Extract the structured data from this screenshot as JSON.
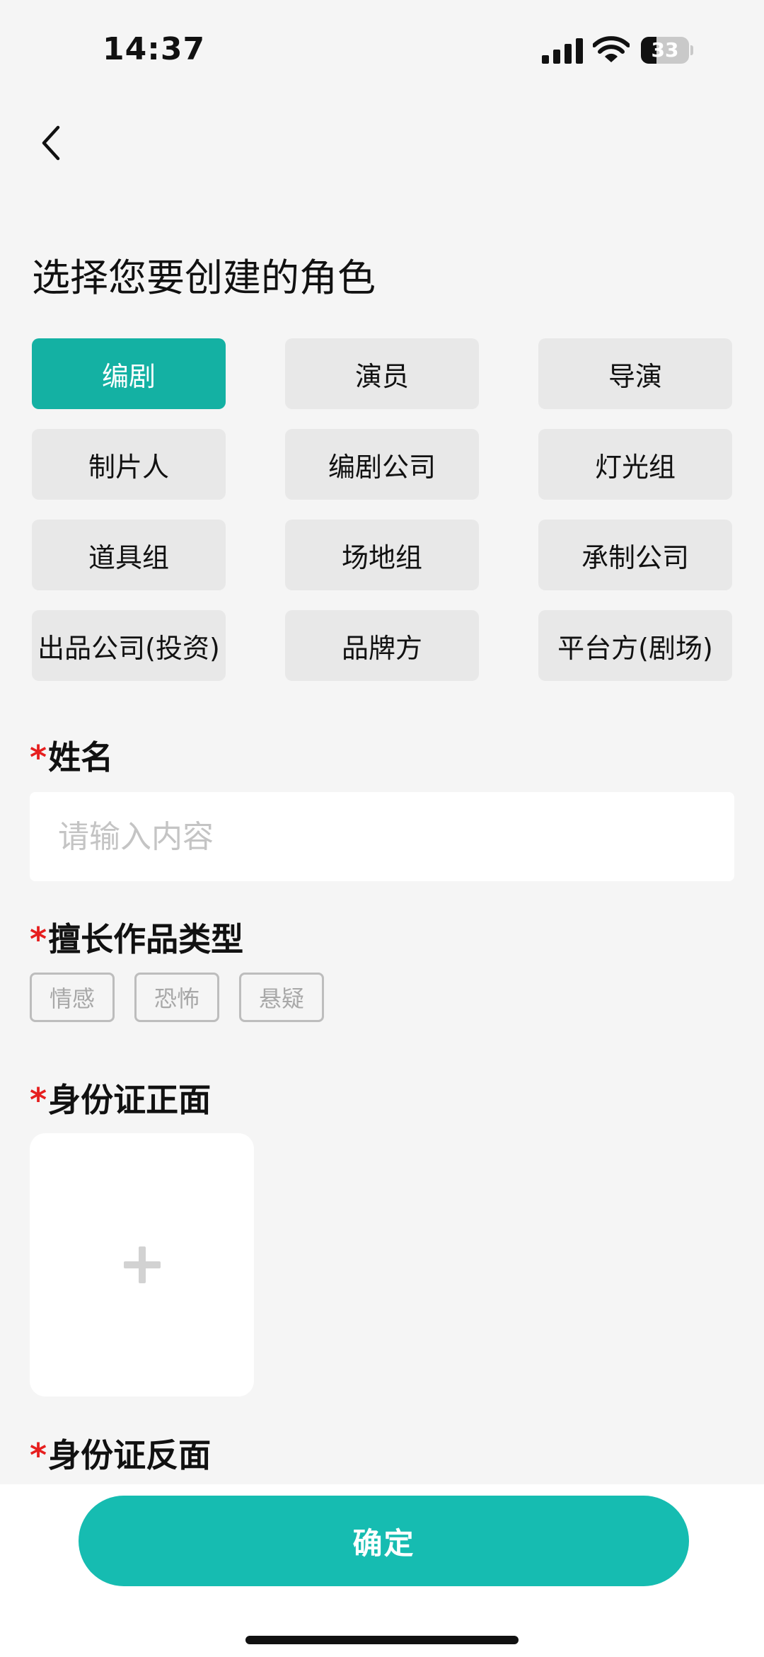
{
  "status_bar": {
    "time": "14:37",
    "battery_level": 33,
    "battery_text": "33"
  },
  "icons": {
    "back": "chevron-left-icon",
    "signal": "signal-icon",
    "wifi": "wifi-icon",
    "battery": "battery-icon",
    "plus": "plus-icon"
  },
  "colors": {
    "accent": "#14b1a3",
    "button": "#16bcb1",
    "required": "#e61f1f",
    "option_bg": "#e8e8e8",
    "page_bg": "#f5f5f5"
  },
  "header": {
    "title": "选择您要创建的角色"
  },
  "roles": {
    "selected": "编剧",
    "items": [
      {
        "label": "编剧",
        "selected": true
      },
      {
        "label": "演员",
        "selected": false
      },
      {
        "label": "导演",
        "selected": false
      },
      {
        "label": "制片人",
        "selected": false
      },
      {
        "label": "编剧公司",
        "selected": false
      },
      {
        "label": "灯光组",
        "selected": false
      },
      {
        "label": "道具组",
        "selected": false
      },
      {
        "label": "场地组",
        "selected": false
      },
      {
        "label": "承制公司",
        "selected": false
      },
      {
        "label": "出品公司(投资)",
        "selected": false
      },
      {
        "label": "品牌方",
        "selected": false
      },
      {
        "label": "平台方(剧场)",
        "selected": false
      }
    ]
  },
  "form": {
    "required_mark": "*",
    "name": {
      "label": "姓名",
      "value": "",
      "placeholder": "请输入内容"
    },
    "genre": {
      "label": "擅长作品类型",
      "tags": [
        "情感",
        "恐怖",
        "悬疑"
      ]
    },
    "id_front": {
      "label": "身份证正面"
    },
    "id_back": {
      "label": "身份证反面"
    }
  },
  "footer": {
    "confirm_label": "确定"
  }
}
